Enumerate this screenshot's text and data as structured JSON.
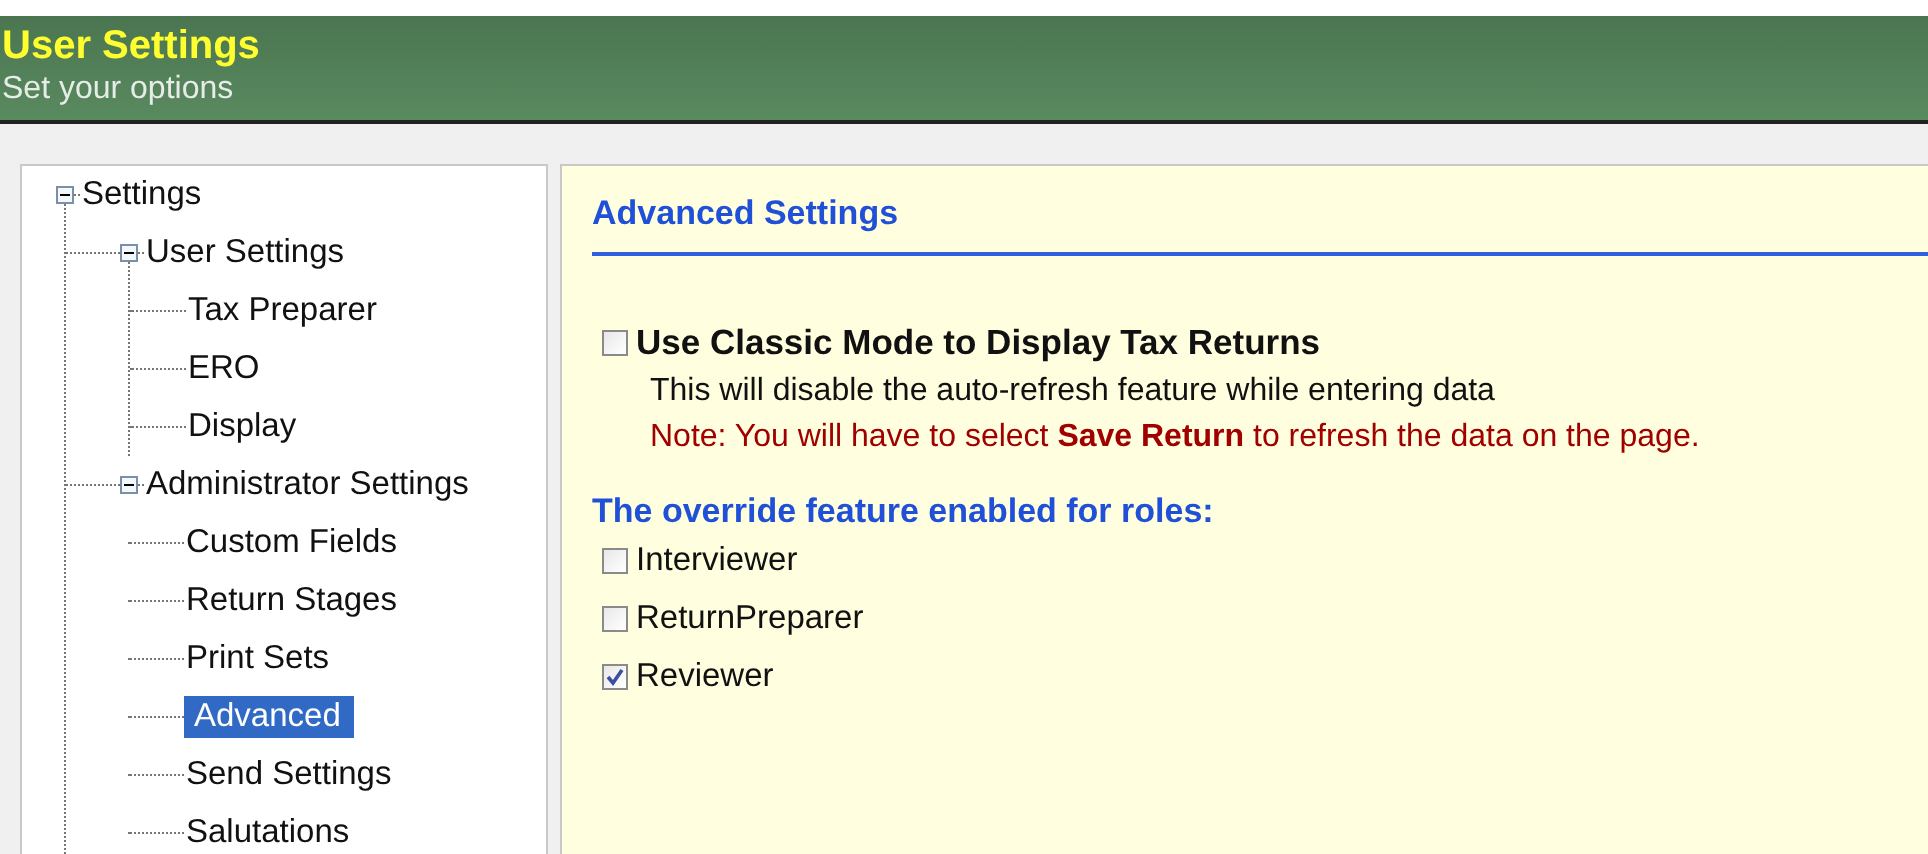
{
  "header": {
    "title": "User Settings",
    "subtitle": "Set your options"
  },
  "tree": [
    {
      "label": "Settings",
      "expanded": true,
      "selected": false,
      "children": [
        {
          "label": "User Settings",
          "expanded": true,
          "selected": false,
          "children": [
            {
              "label": "Tax Preparer",
              "selected": false
            },
            {
              "label": "ERO",
              "selected": false
            },
            {
              "label": "Display",
              "selected": false
            }
          ]
        },
        {
          "label": "Administrator Settings",
          "expanded": true,
          "selected": false,
          "children": [
            {
              "label": "Custom Fields",
              "selected": false
            },
            {
              "label": "Return Stages",
              "selected": false
            },
            {
              "label": "Print Sets",
              "selected": false
            },
            {
              "label": "Advanced",
              "selected": true
            },
            {
              "label": "Send Settings",
              "selected": false
            },
            {
              "label": "Salutations",
              "selected": false
            }
          ]
        }
      ]
    }
  ],
  "panel": {
    "heading": "Advanced Settings",
    "classic_mode": {
      "label": "Use Classic Mode to Display Tax Returns",
      "checked": false,
      "description": "This will disable the auto-refresh feature while entering data",
      "note": "Note: You will have to select **Save Return** to refresh the data on the page."
    },
    "roles_heading": "The override feature enabled for roles:",
    "roles": [
      {
        "label": "Interviewer",
        "checked": false
      },
      {
        "label": "ReturnPreparer",
        "checked": false
      },
      {
        "label": "Reviewer",
        "checked": true
      }
    ]
  }
}
